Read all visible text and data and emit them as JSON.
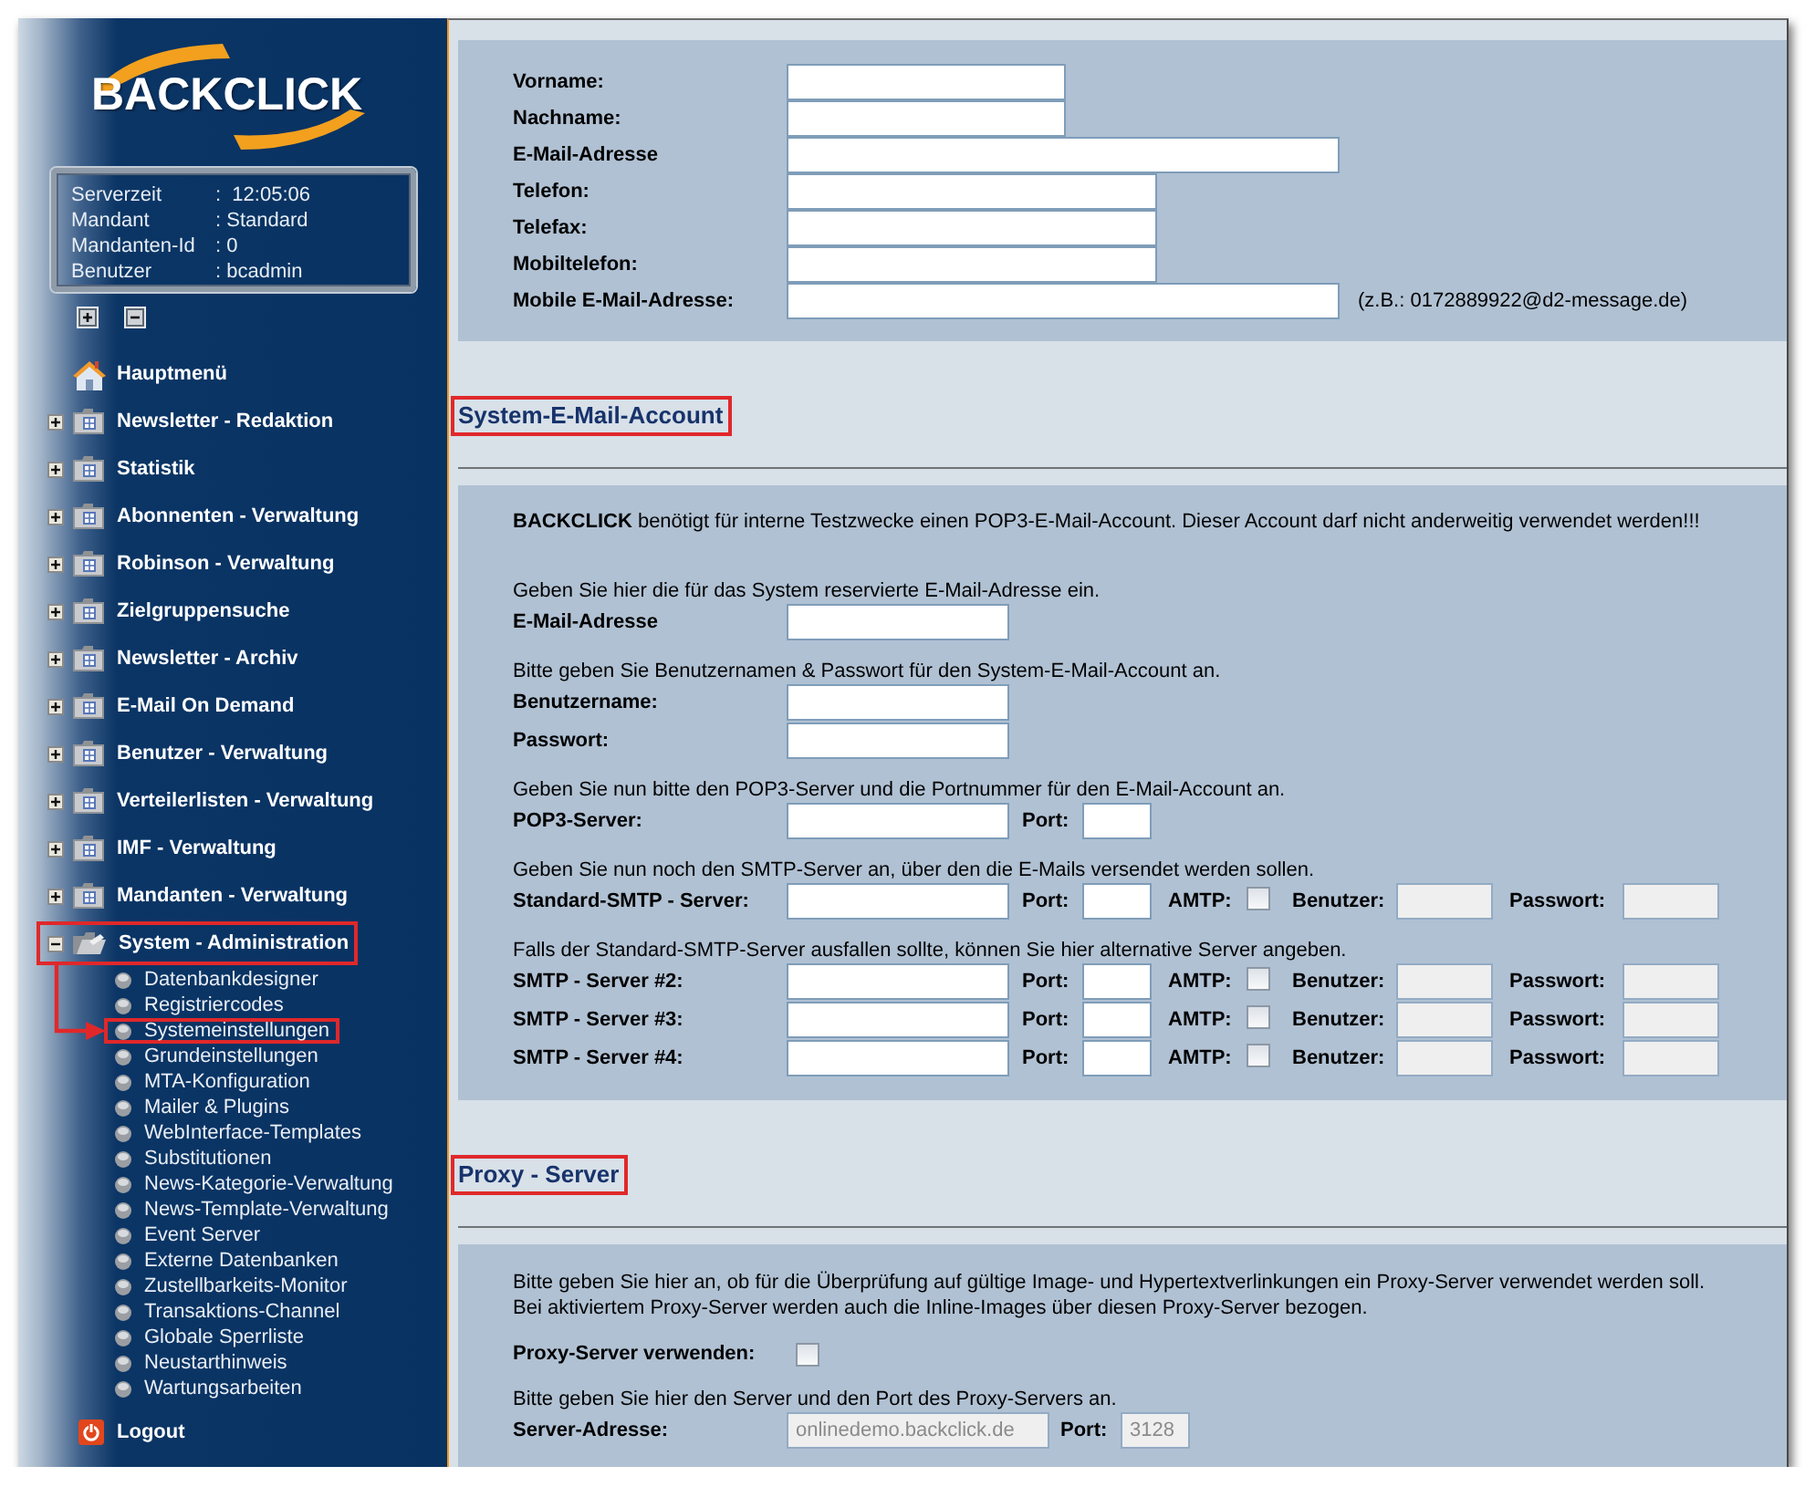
{
  "sidebar": {
    "logo": "BACKCLICK",
    "server_info": [
      {
        "label": "Serverzeit",
        "value": ":  12:05:06"
      },
      {
        "label": "Mandant",
        "value": ": Standard"
      },
      {
        "label": "Mandanten-Id",
        "value": ": 0"
      },
      {
        "label": "Benutzer",
        "value": ": bcadmin"
      }
    ],
    "menu": [
      {
        "kind": "home",
        "label": "Hauptmenü",
        "highlighted": false
      },
      {
        "kind": "folder",
        "label": "Newsletter - Redaktion",
        "expanded": false,
        "highlighted": false
      },
      {
        "kind": "folder",
        "label": "Statistik",
        "expanded": false,
        "highlighted": false
      },
      {
        "kind": "folder",
        "label": "Abonnenten - Verwaltung",
        "expanded": false,
        "highlighted": false
      },
      {
        "kind": "folder",
        "label": "Robinson - Verwaltung",
        "expanded": false,
        "highlighted": false
      },
      {
        "kind": "folder",
        "label": "Zielgruppensuche",
        "expanded": false,
        "highlighted": false
      },
      {
        "kind": "folder",
        "label": "Newsletter - Archiv",
        "expanded": false,
        "highlighted": false
      },
      {
        "kind": "folder",
        "label": "E-Mail On Demand",
        "expanded": false,
        "highlighted": false
      },
      {
        "kind": "folder",
        "label": "Benutzer - Verwaltung",
        "expanded": false,
        "highlighted": false
      },
      {
        "kind": "folder",
        "label": "Verteilerlisten - Verwaltung",
        "expanded": false,
        "highlighted": false
      },
      {
        "kind": "folder",
        "label": "IMF - Verwaltung",
        "expanded": false,
        "highlighted": false
      },
      {
        "kind": "folder",
        "label": "Mandanten - Verwaltung",
        "expanded": false,
        "highlighted": false
      },
      {
        "kind": "folder",
        "label": "System - Administration",
        "expanded": true,
        "highlighted": true,
        "children": [
          {
            "label": "Datenbankdesigner",
            "highlighted": false
          },
          {
            "label": "Registriercodes",
            "highlighted": false
          },
          {
            "label": "Systemeinstellungen",
            "highlighted": true
          },
          {
            "label": "Grundeinstellungen",
            "highlighted": false
          },
          {
            "label": "MTA-Konfiguration",
            "highlighted": false
          },
          {
            "label": "Mailer & Plugins",
            "highlighted": false
          },
          {
            "label": "WebInterface-Templates",
            "highlighted": false
          },
          {
            "label": "Substitutionen",
            "highlighted": false
          },
          {
            "label": "News-Kategorie-Verwaltung",
            "highlighted": false
          },
          {
            "label": "News-Template-Verwaltung",
            "highlighted": false
          },
          {
            "label": "Event Server",
            "highlighted": false
          },
          {
            "label": "Externe Datenbanken",
            "highlighted": false
          },
          {
            "label": "Zustellbarkeits-Monitor",
            "highlighted": false
          },
          {
            "label": "Transaktions-Channel",
            "highlighted": false
          },
          {
            "label": "Globale Sperrliste",
            "highlighted": false
          },
          {
            "label": "Neustarthinweis",
            "highlighted": false
          },
          {
            "label": "Wartungsarbeiten",
            "highlighted": false
          }
        ]
      },
      {
        "kind": "logout",
        "label": "Logout",
        "highlighted": false
      }
    ],
    "annotation_arrow": true
  },
  "contact_form": {
    "fields": [
      {
        "kind": "name",
        "label": "Vorname:"
      },
      {
        "kind": "name",
        "label": "Nachname:"
      },
      {
        "kind": "email",
        "label": "E-Mail-Adresse"
      },
      {
        "kind": "phone",
        "label": "Telefon:"
      },
      {
        "kind": "phone",
        "label": "Telefax:"
      },
      {
        "kind": "phone",
        "label": "Mobiltelefon:"
      },
      {
        "kind": "email",
        "label": "Mobile E-Mail-Adresse:",
        "hint": "(z.B.: 0172889922@d2-message.de)"
      }
    ]
  },
  "system_mail": {
    "heading": "System-E-Mail-Account",
    "highlighted": true,
    "notice": "**BACKCLICK** benötigt für interne Testzwecke einen POP3-E-Mail-Account. Dieser Account darf nicht anderweitig verwendet werden!!!",
    "groups": [
      {
        "hint": "Geben Sie hier die für das System reservierte E-Mail-Adresse ein.",
        "rows": [
          {
            "kind": "field",
            "label": "E-Mail-Adresse"
          }
        ]
      },
      {
        "hint": "Bitte geben Sie Benutzernamen & Passwort für den System-E-Mail-Account an.",
        "rows": [
          {
            "kind": "field",
            "label": "Benutzername:"
          },
          {
            "kind": "field",
            "label": "Passwort:"
          }
        ]
      },
      {
        "hint": "Geben Sie nun bitte den POP3-Server und die Portnummer für den E-Mail-Account an.",
        "rows": [
          {
            "kind": "server",
            "label": "POP3-Server:",
            "port_label": "Port:"
          }
        ]
      },
      {
        "hint": "Geben Sie nun noch den SMTP-Server an, über den die E-Mails versendet werden sollen.",
        "rows": [
          {
            "kind": "smtp",
            "label": "Standard-SMTP - Server:",
            "port_label": "Port:",
            "amtp": {
              "label": "AMTP:",
              "checked": false
            },
            "user": {
              "label": "Benutzer:",
              "disabled": true
            },
            "password": {
              "label": "Passwort:",
              "disabled": true
            }
          }
        ]
      },
      {
        "hint": "Falls der Standard-SMTP-Server ausfallen sollte, können Sie hier alternative Server angeben.",
        "rows": [
          {
            "kind": "smtp",
            "label": "SMTP - Server #2:",
            "port_label": "Port:",
            "amtp": {
              "label": "AMTP:",
              "checked": false
            },
            "user": {
              "label": "Benutzer:",
              "disabled": true
            },
            "password": {
              "label": "Passwort:",
              "disabled": true
            }
          },
          {
            "kind": "smtp",
            "label": "SMTP - Server #3:",
            "port_label": "Port:",
            "amtp": {
              "label": "AMTP:",
              "checked": false
            },
            "user": {
              "label": "Benutzer:",
              "disabled": true
            },
            "password": {
              "label": "Passwort:",
              "disabled": true
            }
          },
          {
            "kind": "smtp",
            "label": "SMTP - Server #4:",
            "port_label": "Port:",
            "amtp": {
              "label": "AMTP:",
              "checked": false
            },
            "user": {
              "label": "Benutzer:",
              "disabled": true
            },
            "password": {
              "label": "Passwort:",
              "disabled": true
            }
          }
        ]
      }
    ]
  },
  "proxy": {
    "heading": "Proxy - Server",
    "highlighted": true,
    "notice": [
      "Bitte geben Sie hier an, ob für die Überprüfung auf gültige Image- und Hypertextverlinkungen ein Proxy-Server verwendet werden soll.",
      "Bei aktiviertem Proxy-Server werden auch die Inline-Images über diesen Proxy-Server bezogen."
    ],
    "use_proxy": {
      "label": "Proxy-Server verwenden:",
      "checked": false
    },
    "hint": "Bitte geben Sie hier den Server und den Port des Proxy-Servers an.",
    "address": {
      "label": "Server-Adresse:",
      "value": "onlinedemo.backclick.de",
      "disabled": true
    },
    "port": {
      "label": "Port:",
      "value": "3128",
      "disabled": true
    }
  }
}
